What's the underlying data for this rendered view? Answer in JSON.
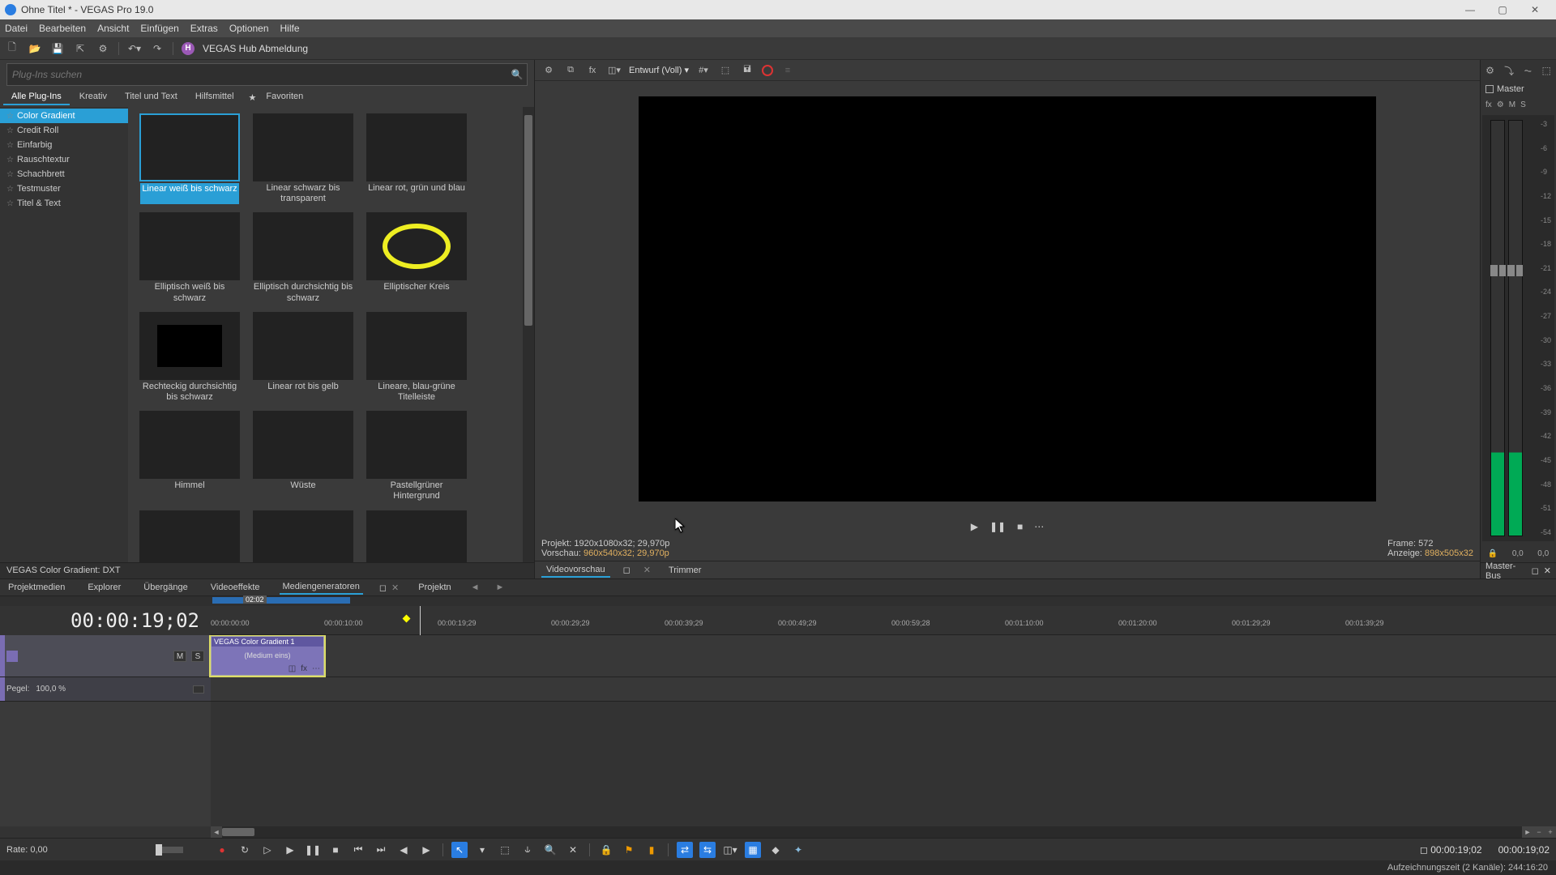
{
  "titlebar": {
    "title": "Ohne Titel * - VEGAS Pro 19.0"
  },
  "menus": [
    "Datei",
    "Bearbeiten",
    "Ansicht",
    "Einfügen",
    "Extras",
    "Optionen",
    "Hilfe"
  ],
  "hub": {
    "label": "VEGAS Hub Abmeldung",
    "pill": "H"
  },
  "search": {
    "placeholder": "Plug-Ins suchen"
  },
  "plugin_tabs": [
    "Alle Plug-Ins",
    "Kreativ",
    "Titel und Text",
    "Hilfsmittel"
  ],
  "plugin_fav": "Favoriten",
  "tree": [
    "Color Gradient",
    "Credit Roll",
    "Einfarbig",
    "Rauschtextur",
    "Schachbrett",
    "Testmuster",
    "Titel & Text"
  ],
  "presets": [
    {
      "label": "Linear weiß bis schwarz",
      "g": "g-wb",
      "sel": true
    },
    {
      "label": "Linear schwarz bis transparent",
      "g": "g-bt"
    },
    {
      "label": "Linear rot, grün und blau",
      "g": "g-rgb"
    },
    {
      "label": "Elliptisch weiß bis schwarz",
      "g": "g-ell-wb"
    },
    {
      "label": "Elliptisch durchsichtig bis schwarz",
      "g": "g-ell-tb"
    },
    {
      "label": "Elliptischer Kreis",
      "g": "g-ell-ring"
    },
    {
      "label": "Rechteckig durchsichtig bis schwarz",
      "g": "g-rect-tb"
    },
    {
      "label": "Linear rot bis gelb",
      "g": "g-ry"
    },
    {
      "label": "Lineare, blau-grüne Titelleiste",
      "g": "g-bg-title"
    },
    {
      "label": "Himmel",
      "g": "g-sky"
    },
    {
      "label": "Wüste",
      "g": "g-desert"
    },
    {
      "label": "Pastellgrüner Hintergrund",
      "g": "g-pastel"
    },
    {
      "label": "",
      "g": "g-lb"
    },
    {
      "label": "",
      "g": "g-pink"
    },
    {
      "label": "",
      "g": "g-fire"
    }
  ],
  "status_line": "VEGAS Color Gradient: DXT",
  "lower_tabs": [
    "Projektmedien",
    "Explorer",
    "Übergänge",
    "Videoeffekte",
    "Mediengeneratoren",
    "Projektn"
  ],
  "preview": {
    "quality": "Entwurf (Voll)",
    "project_label": "Projekt:",
    "project_val": "1920x1080x32; 29,970p",
    "preview_label": "Vorschau:",
    "preview_val": "960x540x32; 29,970p",
    "frame_label": "Frame:",
    "frame_val": "572",
    "display_label": "Anzeige:",
    "display_val": "898x505x32",
    "tabs": {
      "a": "Videovorschau",
      "b": "Trimmer"
    }
  },
  "master": {
    "title": "Master",
    "fx": "fx",
    "cog": "⚙",
    "m": "M",
    "s": "S",
    "ticks": [
      "-3",
      "-6",
      "-9",
      "-12",
      "-15",
      "-18",
      "-21",
      "-24",
      "-27",
      "-30",
      "-33",
      "-36",
      "-39",
      "-42",
      "-45",
      "-48",
      "-51",
      "-54"
    ],
    "b1": "0,0",
    "b2": "0,0",
    "tab": "Master-Bus"
  },
  "timeline": {
    "tc": "00:00:19;02",
    "region_label": "02:02",
    "ruler": [
      "00:00:00:00",
      "00:00:10:00",
      "00:00:19;29",
      "00:00:29;29",
      "00:00:39;29",
      "00:00:49;29",
      "00:00:59;28",
      "00:01:10:00",
      "00:01:20:00",
      "00:01:29;29",
      "00:01:39;29"
    ],
    "track": {
      "m": "M",
      "s": "S",
      "level_label": "Pegel:",
      "level_val": "100,0 %"
    },
    "clip": {
      "title": "VEGAS Color Gradient 1",
      "sub": "(Medium eins)"
    }
  },
  "rate": {
    "label": "Rate: 0,00"
  },
  "tc_right": {
    "a": "00:00:19;02",
    "b": "00:00:19;02"
  },
  "statusbar": "Aufzeichnungszeit (2 Kanäle): 244:16:20"
}
